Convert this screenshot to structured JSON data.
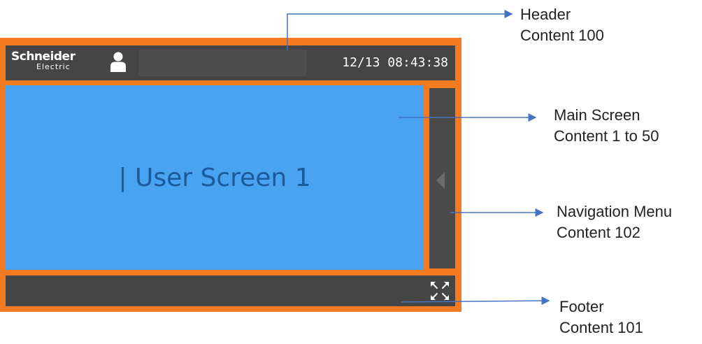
{
  "hmi": {
    "logo": {
      "line1": "Schneider",
      "line2": "Electric"
    },
    "header": {
      "datetime": "12/13 08:43:38"
    },
    "main": {
      "label": "| User Screen 1"
    }
  },
  "annotations": {
    "header": {
      "title": "Header",
      "content": "Content 100"
    },
    "main": {
      "title": "Main Screen",
      "content": "Content 1 to 50"
    },
    "nav": {
      "title": "Navigation Menu",
      "content": "Content 102"
    },
    "footer": {
      "title": "Footer",
      "content": "Content 101"
    }
  },
  "colors": {
    "frame": "#f47b20",
    "panel": "#454545",
    "main_screen": "#4aa3f0",
    "label_text": "#1b5a9c",
    "arrow": "#4472c4"
  },
  "icons": [
    "user-icon",
    "nav-collapse-arrow-icon",
    "expand-icon"
  ]
}
